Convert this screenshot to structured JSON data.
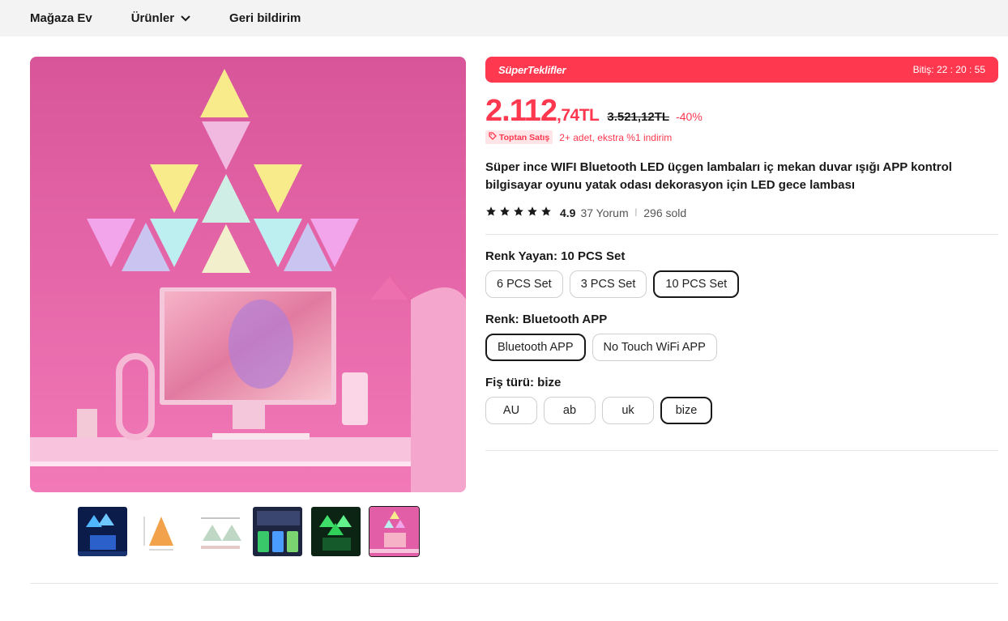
{
  "nav": {
    "items": [
      {
        "label": "Mağaza Ev"
      },
      {
        "label": "Ürünler"
      },
      {
        "label": "Geri bildirim"
      }
    ]
  },
  "deal": {
    "title": "SüperTeklifler",
    "timer": "Bitiş: 22 : 20 : 55"
  },
  "price": {
    "main": "2.112",
    "fraction": ",74TL",
    "original": "3.521,12TL",
    "discount": "-40%"
  },
  "bulk": {
    "badge": "Toptan Satış",
    "text": "2+ adet, ekstra %1 indirim"
  },
  "product": {
    "title": "Süper ince WIFI Bluetooth LED üçgen lambaları iç mekan duvar ışığı APP kontrol bilgisayar oyunu yatak odası dekorasyon için LED gece lambası"
  },
  "rating": {
    "value": "4.9",
    "reviews": "37 Yorum",
    "sold": "296 sold",
    "stars": 5
  },
  "options": {
    "color_emit": {
      "label": "Renk Yayan: 10 PCS Set",
      "values": [
        "6 PCS Set",
        "3 PCS Set",
        "10 PCS Set"
      ],
      "selected": "10 PCS Set"
    },
    "color": {
      "label": "Renk: Bluetooth APP",
      "values": [
        "Bluetooth APP",
        "No Touch WiFi APP"
      ],
      "selected": "Bluetooth APP"
    },
    "plug": {
      "label": "Fiş türü: bize",
      "values": [
        "AU",
        "ab",
        "uk",
        "bize"
      ],
      "selected": "bize"
    }
  },
  "gallery": {
    "thumbnails": [
      "blue-led-setup",
      "orange-triangle-dimensions",
      "triangle-mounting-diagram",
      "app-control-features",
      "green-led-setup",
      "pink-room-setup"
    ],
    "active_index": 5
  },
  "colors": {
    "accent": "#fd384f",
    "text": "#191919",
    "nav_bg": "#f3f3f3"
  }
}
